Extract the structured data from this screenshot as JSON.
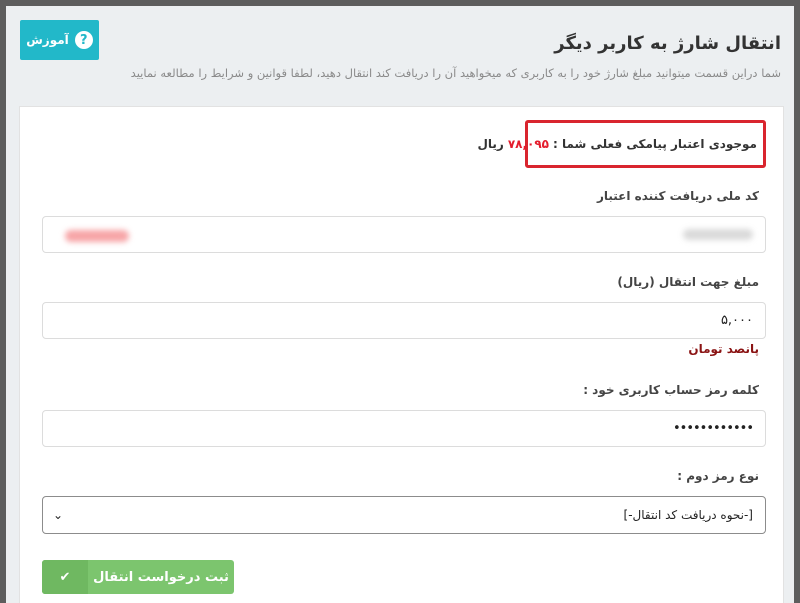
{
  "header": {
    "title": "انتقال شارژ به کاربر دیگر",
    "description": "شما دراین قسمت میتوانید مبلغ شارژ خود را به کاربری که میخواهید آن را دریافت کند انتقال دهید، لطفا قوانین و شرایط را مطالعه نمایید",
    "help_button": "آموزش",
    "help_icon": "?"
  },
  "balance": {
    "label": "موجودی اعتبار پیامکی فعلی شما :",
    "amount": "۷۸,۰۹۵",
    "currency": "ریال"
  },
  "form": {
    "national_code_label": "کد ملی دریافت کننده اعتبار",
    "amount_label": "مبلغ جهت انتقال (ریال)",
    "amount_value": "۵,۰۰۰",
    "amount_words": "پانصد تومان",
    "password_label": "کلمه رمز حساب کاربری خود :",
    "password_value": "••••••••••••",
    "second_pass_label": "نوع رمز دوم :",
    "second_pass_selected": "[-نحوه دریافت کد انتقال-]",
    "submit_label": "ثبت درخواست انتقال",
    "submit_icon": "✔",
    "select_chevron": "⌄"
  }
}
